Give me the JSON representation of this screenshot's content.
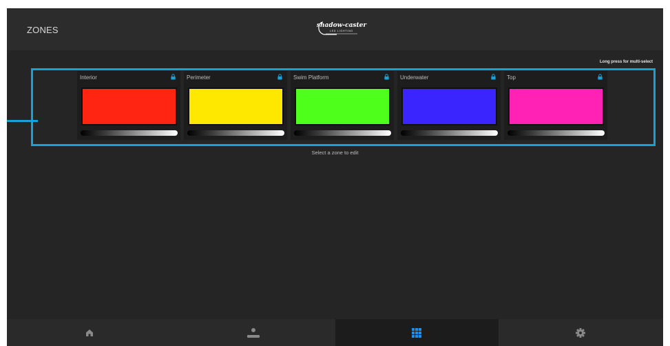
{
  "header": {
    "title": "ZONES",
    "logo_main": "shadow-caster",
    "logo_sub": "LED LIGHTING"
  },
  "hint": "Long press for multi-select",
  "zones": [
    {
      "name": "Interior",
      "color": "#ff2512",
      "icon": "lock-icon"
    },
    {
      "name": "Perimeter",
      "color": "#ffe800",
      "icon": "lock-icon"
    },
    {
      "name": "Swim Platform",
      "color": "#4dff1a",
      "icon": "lock-icon"
    },
    {
      "name": "Underwater",
      "color": "#3a24ff",
      "icon": "lock-icon"
    },
    {
      "name": "Top",
      "color": "#ff22b4",
      "icon": "lock-icon"
    }
  ],
  "status": "Select a zone to edit",
  "nav": [
    {
      "icon": "home-icon",
      "active": false
    },
    {
      "icon": "user-icon",
      "active": false
    },
    {
      "icon": "grid-icon",
      "active": true
    },
    {
      "icon": "gear-icon",
      "active": false
    }
  ],
  "colors": {
    "accent": "#19a0d9",
    "background": "#252525",
    "header": "#2c2c2c"
  }
}
